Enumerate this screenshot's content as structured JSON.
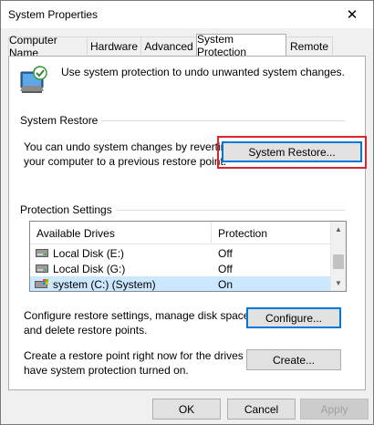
{
  "window": {
    "title": "System Properties"
  },
  "tabs": [
    {
      "label": "Computer Name"
    },
    {
      "label": "Hardware"
    },
    {
      "label": "Advanced"
    },
    {
      "label": "System Protection",
      "active": true
    },
    {
      "label": "Remote"
    }
  ],
  "intro": {
    "text": "Use system protection to undo unwanted system changes."
  },
  "system_restore": {
    "group_label": "System Restore",
    "description_line1": "You can undo system changes by reverting",
    "description_line2": "your computer to a previous restore point.",
    "button_label": "System Restore..."
  },
  "protection": {
    "group_label": "Protection Settings",
    "columns": [
      "Available Drives",
      "Protection"
    ],
    "drives": [
      {
        "name": "Local Disk (E:)",
        "protection": "Off",
        "icon": "hard-drive-icon"
      },
      {
        "name": "Local Disk (G:)",
        "protection": "Off",
        "icon": "hard-drive-icon"
      },
      {
        "name": "system (C:) (System)",
        "protection": "On",
        "icon": "system-drive-icon",
        "selected": true
      }
    ],
    "configure_line1": "Configure restore settings, manage disk space,",
    "configure_line2": "and delete restore points.",
    "configure_button": "Configure...",
    "create_line1": "Create a restore point right now for the drives that",
    "create_line2": "have system protection turned on.",
    "create_button": "Create..."
  },
  "footer": {
    "ok": "OK",
    "cancel": "Cancel",
    "apply": "Apply"
  },
  "colors": {
    "highlight": "#d6262e",
    "selection": "#cce8ff",
    "accent": "#0078d7"
  }
}
